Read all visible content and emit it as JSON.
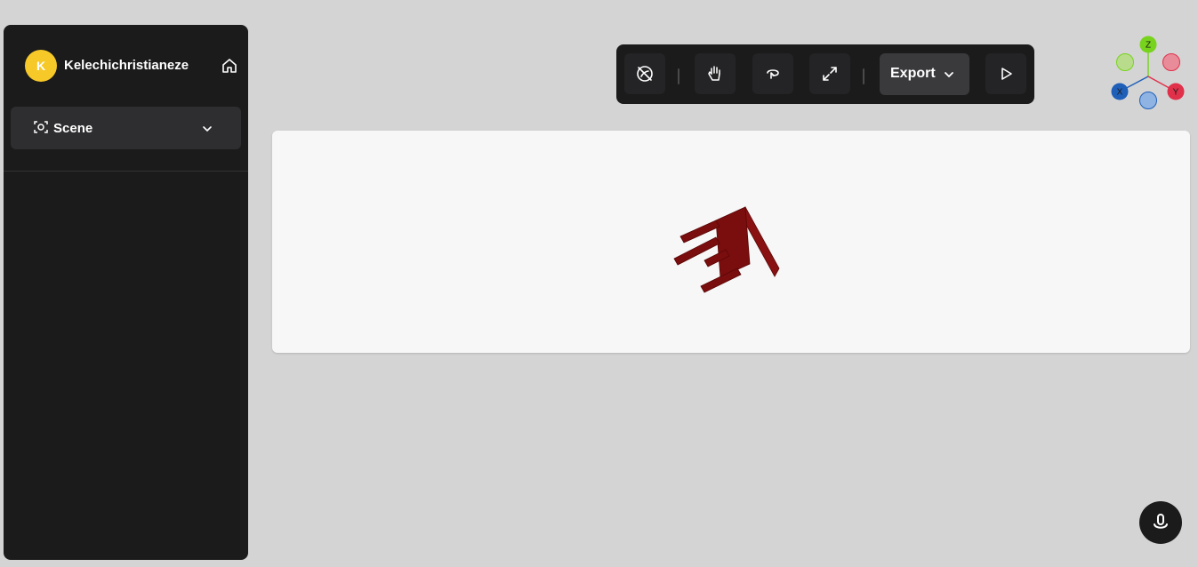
{
  "user": {
    "initial": "K",
    "name": "Kelechichristianeze"
  },
  "sidebar": {
    "scene_label": "Scene"
  },
  "toolbar": {
    "buttons": [
      "orbit-lock-off-icon",
      "pan-hand-icon",
      "rotate-icon",
      "fullscreen-icon"
    ],
    "export_label": "Export",
    "play_icon": "play-icon"
  },
  "colors": {
    "sidebar_bg": "#1b1b1b",
    "avatar": "#f7c928",
    "model": "#7a0d0d",
    "axis_x": "#1f5fb8",
    "axis_y": "#e0304a",
    "axis_z": "#77d31b"
  },
  "gizmo": {
    "x": "X",
    "y": "Y",
    "z": "Z"
  }
}
